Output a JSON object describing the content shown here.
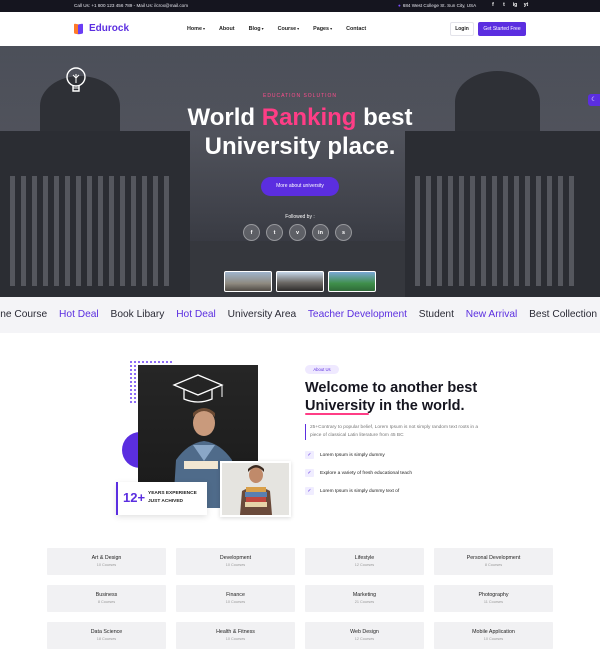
{
  "topbar": {
    "contact": "Call Us: +1 800 123 456 789 - Mail Us: ilcrox@mail.com",
    "address": "684 West College St. Sun City, USA",
    "socials": [
      "f",
      "t",
      "ig",
      "yt"
    ]
  },
  "nav": {
    "logo": "Edurock",
    "menu": [
      {
        "label": "Home",
        "dropdown": true
      },
      {
        "label": "About",
        "dropdown": false
      },
      {
        "label": "Blog",
        "dropdown": true
      },
      {
        "label": "Course",
        "dropdown": true
      },
      {
        "label": "Pages",
        "dropdown": true
      },
      {
        "label": "Contact",
        "dropdown": false
      }
    ],
    "login": "Login",
    "cta": "Get Started Free"
  },
  "hero": {
    "kicker": "EDUCATION SOLUTION",
    "title_line1_a": "World ",
    "title_line1_hl": "Ranking",
    "title_line1_b": " best",
    "title_line2": "University place.",
    "button": "More about university",
    "followed": "Followed by :",
    "socials": [
      "f",
      "t",
      "v",
      "in",
      "s"
    ]
  },
  "marquee": [
    {
      "text": "nline Course",
      "accent": false
    },
    {
      "text": "Hot Deal",
      "accent": true
    },
    {
      "text": "Book Libary",
      "accent": false
    },
    {
      "text": "Hot Deal",
      "accent": true
    },
    {
      "text": "University Area",
      "accent": false
    },
    {
      "text": "Teacher Development",
      "accent": true
    },
    {
      "text": "Student",
      "accent": false
    },
    {
      "text": "New Arrival",
      "accent": true
    },
    {
      "text": "Best Collection",
      "accent": false
    }
  ],
  "about": {
    "badge": "About Us",
    "title_a": "Welcome to another best ",
    "title_u": "University",
    "title_b": " in the world.",
    "desc": "25+Contrary to popular belief, Lorem Ipsum is not simply random text roots in a piece of classical Latin literature from 45 BC",
    "checks": [
      "Lorem Ipsum is simply dummy",
      "Explore a variety of fresh educational teach",
      "Lorem Ipsum is simply dummy text of"
    ],
    "exp_num": "12+",
    "exp_label": "YEARS EXPERIENCE JUST ACHIVED"
  },
  "categories": [
    {
      "name": "Art & Design",
      "count": "10 Courses"
    },
    {
      "name": "Development",
      "count": "10 Courses"
    },
    {
      "name": "Lifestyle",
      "count": "12 Courses"
    },
    {
      "name": "Personal Development",
      "count": "8 Courses"
    },
    {
      "name": "Business",
      "count": "8 Courses"
    },
    {
      "name": "Finance",
      "count": "10 Courses"
    },
    {
      "name": "Marketing",
      "count": "21 Courses"
    },
    {
      "name": "Photography",
      "count": "11 Courses"
    },
    {
      "name": "Data Science",
      "count": "18 Courses"
    },
    {
      "name": "Health & Fitness",
      "count": "10 Courses"
    },
    {
      "name": "Web Design",
      "count": "12 Courses"
    },
    {
      "name": "Mobile Application",
      "count": "10 Courses"
    }
  ],
  "colors": {
    "primary": "#5b2ee0",
    "accent": "#ff3d86"
  }
}
